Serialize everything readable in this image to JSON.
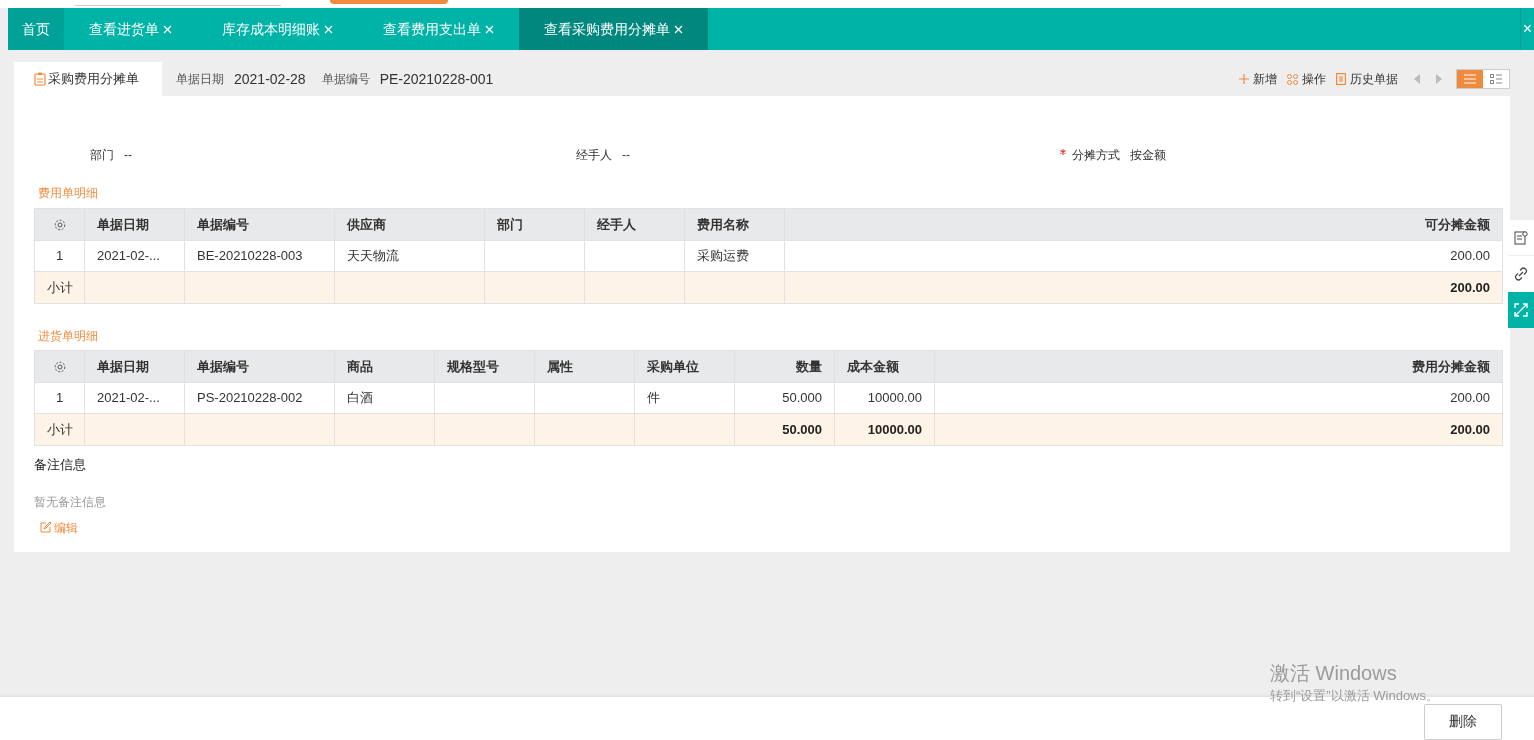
{
  "tabs": [
    {
      "label": "首页",
      "closable": false,
      "selected": false
    },
    {
      "label": "查看进货单",
      "closable": true,
      "selected": false
    },
    {
      "label": "库存成本明细账",
      "closable": true,
      "selected": false
    },
    {
      "label": "查看费用支出单",
      "closable": true,
      "selected": false
    },
    {
      "label": "查看采购费用分摊单",
      "closable": true,
      "selected": true
    }
  ],
  "tab_bar_close": "×",
  "doc": {
    "title": "采购费用分摊单",
    "meta": [
      {
        "label": "单据日期",
        "value": "2021-02-28"
      },
      {
        "label": "单据编号",
        "value": "PE-20210228-001"
      }
    ],
    "actions": [
      {
        "kind": "add",
        "label": "新增"
      },
      {
        "kind": "operate",
        "label": "操作"
      },
      {
        "kind": "history",
        "label": "历史单据"
      }
    ],
    "view_toggles": [
      {
        "kind": "list",
        "selected": true
      },
      {
        "kind": "detail",
        "selected": false
      }
    ]
  },
  "fields": [
    {
      "label": "部门",
      "value": "--",
      "required": false
    },
    {
      "label": "经手人",
      "value": "--",
      "required": false
    },
    {
      "label": "分摊方式",
      "value": "按金额",
      "required": true
    }
  ],
  "tables": [
    {
      "title": "费用单明细",
      "columns": [
        {
          "kind": "settings"
        },
        {
          "kind": "text",
          "label": "单据日期"
        },
        {
          "kind": "text",
          "label": "单据编号"
        },
        {
          "kind": "text",
          "label": "供应商"
        },
        {
          "kind": "text",
          "label": "部门"
        },
        {
          "kind": "text",
          "label": "经手人"
        },
        {
          "kind": "text",
          "label": "费用名称"
        },
        {
          "kind": "text",
          "label": "可分摊金额"
        }
      ],
      "rows": [
        [
          "1",
          "2021-02-...",
          "BE-20210228-003",
          "天天物流",
          null,
          null,
          "采购运费",
          "200.00"
        ]
      ],
      "subtotal": {
        "label": "小计",
        "totals": [
          "200.00"
        ]
      }
    },
    {
      "title": "进货单明细",
      "columns": [
        {
          "kind": "settings"
        },
        {
          "kind": "text",
          "label": "单据日期"
        },
        {
          "kind": "text",
          "label": "单据编号"
        },
        {
          "kind": "text",
          "label": "商品"
        },
        {
          "kind": "text",
          "label": "规格型号"
        },
        {
          "kind": "text",
          "label": "属性"
        },
        {
          "kind": "text",
          "label": "采购单位"
        },
        {
          "kind": "text",
          "label": "数量"
        },
        {
          "kind": "text",
          "label": "成本金额"
        },
        {
          "kind": "text",
          "label": "费用分摊金额"
        }
      ],
      "rows": [
        [
          "1",
          "2021-02-...",
          "PS-20210228-002",
          "白酒",
          null,
          null,
          "件",
          "50.000",
          "10000.00",
          "200.00"
        ]
      ],
      "subtotal": {
        "label": "小计",
        "totals": [
          "50.000",
          "10000.00",
          "200.00"
        ]
      }
    }
  ],
  "remarks": {
    "title": "备注信息",
    "empty_text": "暂无备注信息",
    "edit_label": "编辑"
  },
  "windows_notice": {
    "title": "激活 Windows",
    "text": "转到“设置”以激活 Windows。"
  },
  "footer_buttons": [
    "删除"
  ]
}
